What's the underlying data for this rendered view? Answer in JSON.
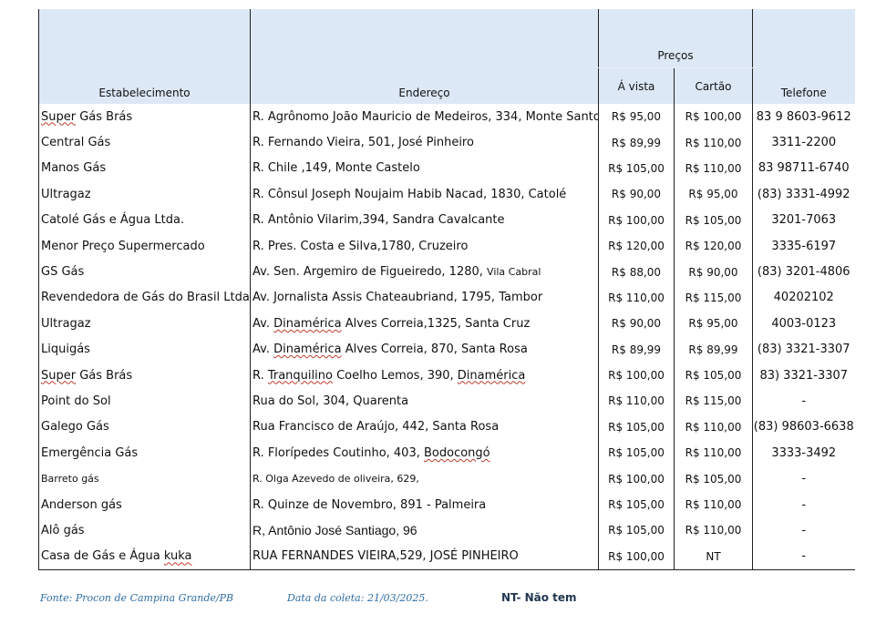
{
  "header": {
    "estabelecimento": "Estabelecimento",
    "endereco": "Endereço",
    "precos": "Preços",
    "a_vista": "Á vista",
    "cartao": "Cartão",
    "telefone": "Telefone"
  },
  "rows": [
    {
      "est": "Super Gás Brás",
      "end": "R. Agrônomo João Mauricio de Medeiros, 334, Monte Santo",
      "av": "R$ 95,00",
      "ca": "R$ 100,00",
      "tel": "83 9 8603-9612"
    },
    {
      "est": "Central Gás",
      "end": "R. Fernando Vieira, 501, José Pinheiro",
      "av": "R$ 89,99",
      "ca": "R$ 110,00",
      "tel": "3311-2200"
    },
    {
      "est": "Manos Gás",
      "end": "R. Chile ,149, Monte Castelo",
      "av": "R$ 105,00",
      "ca": "R$ 110,00",
      "tel": "83 98711-6740"
    },
    {
      "est": "Ultragaz",
      "end": "R. Cônsul Joseph Noujaim Habib Nacad, 1830, Catolé",
      "av": "R$ 90,00",
      "ca": "R$ 95,00",
      "tel": "(83) 3331-4992"
    },
    {
      "est": "Catolé Gás e Água Ltda.",
      "end": "R. Antônio Vilarim,394, Sandra Cavalcante",
      "av": "R$ 100,00",
      "ca": "R$ 105,00",
      "tel": "3201-7063"
    },
    {
      "est": "Menor Preço Supermercado",
      "end": "R. Pres. Costa e Silva,1780, Cruzeiro",
      "av": "R$ 120,00",
      "ca": "R$ 120,00",
      "tel": "3335-6197"
    },
    {
      "est": "GS Gás",
      "end_a": "Av. Sen. Argemiro de Figueiredo, 1280, ",
      "end_b": "Vila Cabral",
      "av": "R$ 88,00",
      "ca": "R$ 90,00",
      "tel": "(83) 3201-4806"
    },
    {
      "est": "Revendedora de Gás do Brasil Ltda.",
      "end": "Av. Jornalista Assis Chateaubriand, 1795, Tambor",
      "av": "R$ 110,00",
      "ca": "R$ 115,00",
      "tel": "40202102"
    },
    {
      "est": "Ultragaz",
      "end": "Av. Dinamérica Alves Correia,1325, Santa Cruz",
      "av": "R$ 90,00",
      "ca": "R$ 95,00",
      "tel": "4003-0123"
    },
    {
      "est": "Liquigás",
      "end": "Av. Dinamérica Alves Correia, 870, Santa Rosa",
      "av": "R$ 89,99",
      "ca": "R$ 89,99",
      "tel": "(83) 3321-3307"
    },
    {
      "est": "Super Gás Brás",
      "end": "R. Tranquilino Coelho Lemos, 390, Dinamérica",
      "av": "R$ 100,00",
      "ca": "R$ 105,00",
      "tel": "83) 3321-3307"
    },
    {
      "est": "Point do Sol",
      "end": "Rua do Sol, 304, Quarenta",
      "av": "R$ 110,00",
      "ca": "R$ 115,00",
      "tel": "-"
    },
    {
      "est": "Galego Gás",
      "end": "Rua Francisco de Araújo, 442, Santa Rosa",
      "av": "R$ 105,00",
      "ca": "R$ 110,00",
      "tel": "(83) 98603-6638"
    },
    {
      "est": "Emergência Gás",
      "end": "R. Florípedes Coutinho, 403, Bodocongó",
      "av": "R$ 105,00",
      "ca": "R$ 110,00",
      "tel": "3333-3492"
    },
    {
      "est": "Barreto gás",
      "end": "R. Olga Azevedo de oliveira, 629,",
      "av": "R$ 100,00",
      "ca": "R$ 105,00",
      "tel": "-"
    },
    {
      "est": "Anderson gás",
      "end": "R. Quinze de Novembro, 891 - Palmeira",
      "av": "R$ 105,00",
      "ca": "R$ 110,00",
      "tel": "-"
    },
    {
      "est": "Alô gás",
      "end": "R, Antônio José Santiago, 96",
      "av": "R$ 105,00",
      "ca": "R$ 110,00",
      "tel": "-"
    },
    {
      "est": "Casa de Gás e Água kuka",
      "end": "RUA FERNANDES VIEIRA,529, JOSÉ PINHEIRO",
      "av": "R$ 100,00",
      "ca": "NT",
      "tel": "-"
    }
  ],
  "footer": {
    "fonte": "Fonte: Procon de Campina Grande/PB",
    "data": "Data da coleta: 21/03/2025.",
    "nt": "NT- Não tem"
  }
}
